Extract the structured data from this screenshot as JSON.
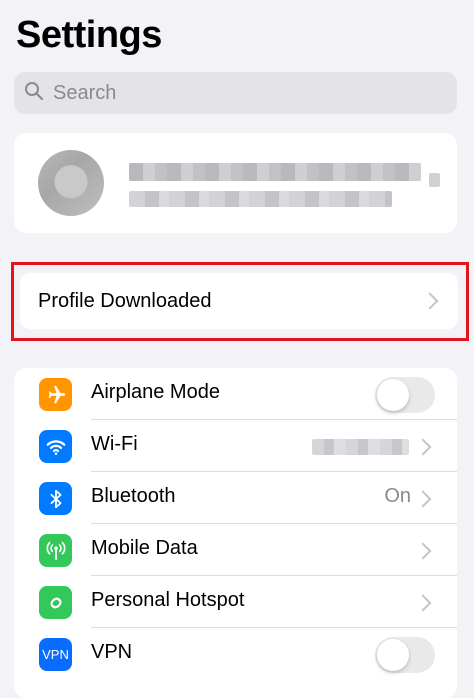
{
  "header": {
    "title": "Settings"
  },
  "search": {
    "placeholder": "Search",
    "icon": "magnifier"
  },
  "account": {
    "name": "",
    "subtitle": ""
  },
  "profile_row": {
    "label": "Profile Downloaded",
    "highlight_color": "#e3141c"
  },
  "settings_rows": [
    {
      "label": "Airplane Mode",
      "icon": "airplane-icon",
      "icon_color": "#ff9500",
      "control": "toggle",
      "on": false
    },
    {
      "label": "Wi-Fi",
      "icon": "wifi-icon",
      "icon_color": "#007aff",
      "control": "chevron",
      "value": ""
    },
    {
      "label": "Bluetooth",
      "icon": "bluetooth-icon",
      "icon_color": "#007aff",
      "control": "chevron",
      "value": "On"
    },
    {
      "label": "Mobile Data",
      "icon": "antenna-icon",
      "icon_color": "#34c759",
      "control": "chevron"
    },
    {
      "label": "Personal Hotspot",
      "icon": "hotspot-icon",
      "icon_color": "#34c759",
      "control": "chevron"
    },
    {
      "label": "VPN",
      "icon": "vpn-icon",
      "icon_text": "VPN",
      "icon_color": "#0a6cff",
      "control": "toggle",
      "on": false
    }
  ]
}
